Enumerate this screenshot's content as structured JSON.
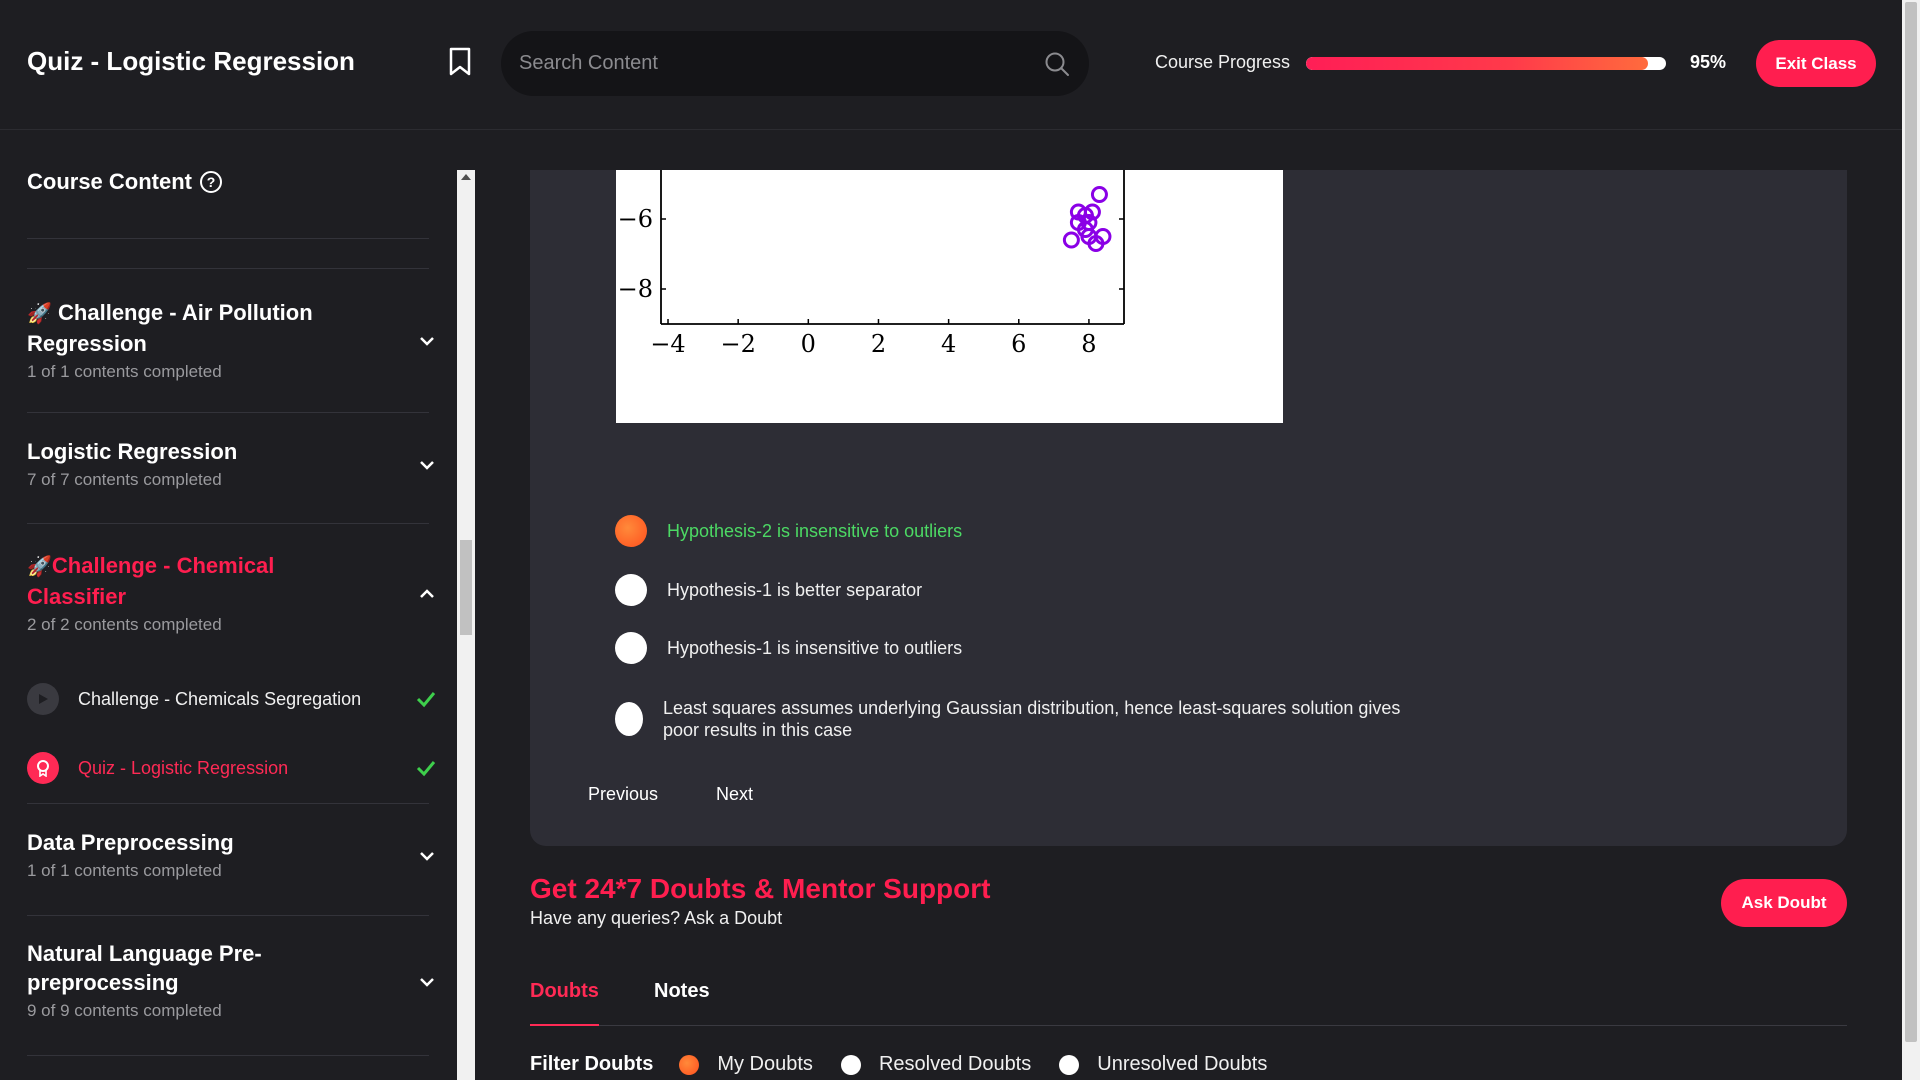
{
  "header": {
    "title": "Quiz - Logistic Regression",
    "search_placeholder": "Search Content",
    "progress_label": "Course Progress",
    "progress_value": 0.95,
    "progress_text": "95%",
    "exit_label": "Exit Class"
  },
  "sidebar": {
    "title": "Course Content",
    "sections": [
      {
        "title": "Challenge - Air Pollution Regression",
        "icon": "rocket-icon",
        "sub": "1 of 1 contents completed",
        "expanded": false
      },
      {
        "title": "Logistic Regression",
        "sub": "7 of 7 contents completed",
        "expanded": false
      },
      {
        "title": "Challenge - Chemical Classifier",
        "icon": "rocket-icon",
        "sub": "2 of 2 contents completed",
        "expanded": true
      },
      {
        "title": "Data Preprocessing",
        "sub": "1 of 1 contents completed",
        "expanded": false
      },
      {
        "title": "Natural Language Pre-preprocessing",
        "sub": "9 of 9 contents completed",
        "expanded": false
      }
    ],
    "lessons": [
      {
        "label": "Challenge - Chemicals Segregation",
        "icon": "play-icon",
        "done": true
      },
      {
        "label": "Quiz - Logistic Regression",
        "icon": "quiz-badge-icon",
        "done": true,
        "active": true
      }
    ]
  },
  "chart_data": {
    "type": "scatter",
    "xticks": [
      "−4",
      "−2",
      "0",
      "2",
      "4",
      "6",
      "8"
    ],
    "yticks": [
      "−6",
      "−8"
    ],
    "points": [
      [
        8.3,
        -5.3
      ],
      [
        7.7,
        -5.8
      ],
      [
        8.1,
        -5.8
      ],
      [
        7.9,
        -5.9
      ],
      [
        7.7,
        -6.1
      ],
      [
        8.0,
        -6.1
      ],
      [
        7.9,
        -6.3
      ],
      [
        7.5,
        -6.6
      ],
      [
        8.0,
        -6.5
      ],
      [
        8.4,
        -6.5
      ],
      [
        8.2,
        -6.7
      ]
    ]
  },
  "quiz": {
    "options": [
      {
        "text": "Hypothesis-2 is insensitive to outliers",
        "selected": true,
        "correct": true
      },
      {
        "text": "Hypothesis-1 is better separator",
        "selected": false
      },
      {
        "text": "Hypothesis-1 is insensitive to outliers",
        "selected": false
      },
      {
        "text": "Least squares assumes underlying Gaussian distribution, hence least-squares solution gives poor results in this case",
        "selected": false
      }
    ],
    "prev_label": "Previous",
    "next_label": "Next"
  },
  "doubts": {
    "title": "Get 24*7 Doubts & Mentor Support",
    "subtitle": "Have any queries? Ask a Doubt",
    "ask_label": "Ask Doubt",
    "tabs": [
      "Doubts",
      "Notes"
    ],
    "filter_label": "Filter Doubts",
    "filters": [
      "My Doubts",
      "Resolved Doubts",
      "Unresolved Doubts"
    ],
    "colors": {
      "accent": "#ff1e4f",
      "correct": "#4cd964"
    }
  }
}
